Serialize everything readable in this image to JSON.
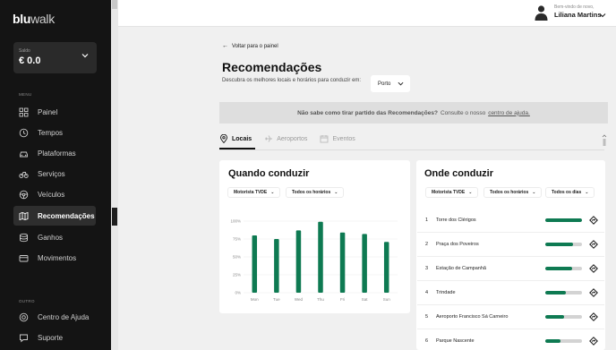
{
  "sidebar": {
    "logo_a": "blu",
    "logo_b": "walk",
    "balance_label": "Saldo",
    "balance_value": "€ 0.0",
    "menu_label": "MENU",
    "items": [
      {
        "label": "Painel",
        "icon": "grid-icon"
      },
      {
        "label": "Tempos",
        "icon": "clock-icon"
      },
      {
        "label": "Plataformas",
        "icon": "car-icon"
      },
      {
        "label": "Serviços",
        "icon": "bike-icon"
      },
      {
        "label": "Veículos",
        "icon": "steering-icon"
      },
      {
        "label": "Recomendações",
        "icon": "map-icon"
      },
      {
        "label": "Ganhos",
        "icon": "coins-icon"
      },
      {
        "label": "Movimentos",
        "icon": "card-icon"
      }
    ],
    "other_label": "OUTRO",
    "other_items": [
      {
        "label": "Centro de Ajuda",
        "icon": "help-icon"
      },
      {
        "label": "Suporte",
        "icon": "chat-icon"
      }
    ]
  },
  "header": {
    "greeting": "Bem-vindo de novo,",
    "user_name": "Liliana Martins"
  },
  "page": {
    "back_label": "Voltar para o painel",
    "title": "Recomendações",
    "subtitle": "Descubra os melhores locais e horários para conduzir em:",
    "city": "Porto",
    "help_bold": "Não sabe como tirar partido das Recomendações?",
    "help_rest": "Consulte o nosso",
    "help_link": "centro de ajuda."
  },
  "tabs": [
    {
      "label": "Locais",
      "icon": "pin-icon",
      "active": true
    },
    {
      "label": "Aeroportos",
      "icon": "plane-icon",
      "active": false
    },
    {
      "label": "Eventos",
      "icon": "calendar-icon",
      "active": false
    }
  ],
  "when_card": {
    "title": "Quando conduzir",
    "filter_driver": "Motorista TVDE",
    "filter_hours": "Todos os horários"
  },
  "where_card": {
    "title": "Onde conduzir",
    "filter_driver": "Motorista TVDE",
    "filter_hours": "Todos os horários",
    "filter_days": "Todos os dias",
    "places": [
      {
        "rank": "1",
        "name": "Torre dos Clérigos",
        "level": 1.0
      },
      {
        "rank": "2",
        "name": "Praça dos Poveiros",
        "level": 0.75
      },
      {
        "rank": "3",
        "name": "Estação de Campanhã",
        "level": 0.72
      },
      {
        "rank": "4",
        "name": "Trindade",
        "level": 0.55
      },
      {
        "rank": "5",
        "name": "Aeroporto Francisco Sá Carneiro",
        "level": 0.52
      },
      {
        "rank": "6",
        "name": "Parque Nascente",
        "level": 0.42
      }
    ]
  },
  "colors": {
    "accent": "#0e7a52",
    "sidebar_bg": "#141414"
  },
  "chart_data": {
    "type": "bar",
    "categories": [
      "Mon",
      "Tue",
      "Wed",
      "Thu",
      "Fri",
      "Sat",
      "Sun"
    ],
    "values": [
      80,
      75,
      87,
      99,
      84,
      82,
      71
    ],
    "ylim": [
      0,
      100
    ],
    "yticks": [
      "0%",
      "25%",
      "50%",
      "75%",
      "100%"
    ],
    "grid": true,
    "color": "#0e7a52"
  }
}
